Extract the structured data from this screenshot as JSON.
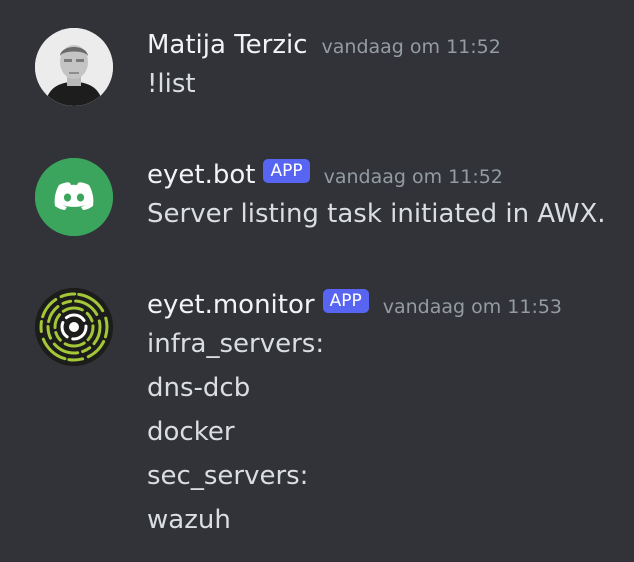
{
  "messages": [
    {
      "author": "Matija Terzic",
      "timestamp": "vandaag om 11:52",
      "avatar_icon": "user-photo-avatar",
      "lines": [
        "!list"
      ]
    },
    {
      "author": "eyet.bot",
      "tag": "APP",
      "timestamp": "vandaag om 11:52",
      "avatar_icon": "discord-logo-icon",
      "avatar_color": "#3ba55d",
      "lines": [
        "Server listing task initiated in AWX."
      ]
    },
    {
      "author": "eyet.monitor",
      "tag": "APP",
      "timestamp": "vandaag om 11:53",
      "avatar_icon": "radar-rings-icon",
      "avatar_color": "#a4c639",
      "lines": [
        "infra_servers:",
        "dns-dcb",
        "docker",
        "sec_servers:",
        "wazuh"
      ]
    }
  ]
}
